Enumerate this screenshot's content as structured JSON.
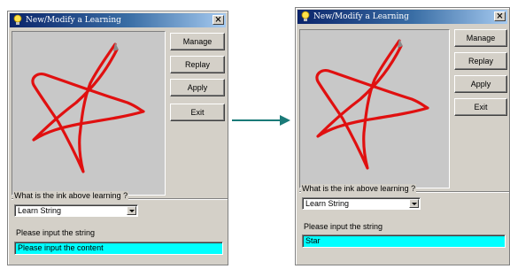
{
  "colors": {
    "ink": "#e01010",
    "input_highlight": "#00ffff",
    "arrow": "#1a7a78",
    "titlebar_start": "#0a246a"
  },
  "windows": [
    {
      "title": "New/Modify a Learning",
      "close_label": "×",
      "buttons": {
        "manage": "Manage",
        "replay": "Replay",
        "apply": "Apply",
        "exit": "Exit"
      },
      "question_label": "What is the ink above learning ?",
      "combo_value": "Learn String",
      "input_label": "Please input the string",
      "input_value": "Please input the content"
    },
    {
      "title": "New/Modify a Learning",
      "close_label": "×",
      "buttons": {
        "manage": "Manage",
        "replay": "Replay",
        "apply": "Apply",
        "exit": "Exit"
      },
      "question_label": "What is the ink above learning ?",
      "combo_value": "Learn String",
      "input_label": "Please input the string",
      "input_value": "Star"
    }
  ],
  "icons": {
    "title_icon": "lightbulb-icon",
    "close_icon": "close-icon",
    "transition": "right-arrow-icon"
  }
}
